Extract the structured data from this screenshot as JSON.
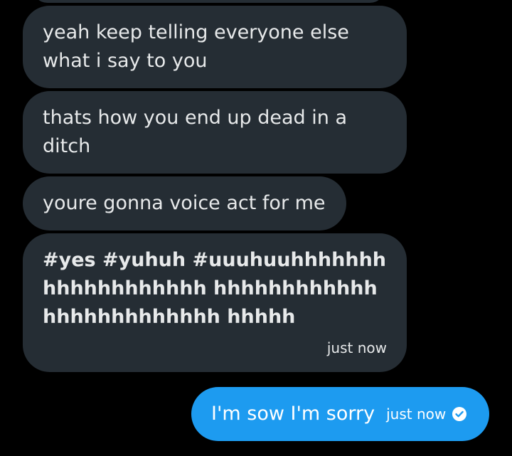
{
  "conversation": {
    "incoming": [
      {
        "text": "yeah keep telling everyone else what i say to you"
      },
      {
        "text": "thats how you end up dead in a ditch"
      },
      {
        "text": "youre gonna voice act for me"
      },
      {
        "text": "#yes #yuhuh #uuuhuuhhhhhhhhhhhhhhhhhhh hhhhhhhhhhhhhhhhhhhhhhhhh hhhhh",
        "time": "just now"
      }
    ],
    "outgoing": {
      "text": "I'm sow I'm sorry",
      "time": "just now",
      "status_icon": "check-circle-icon"
    }
  },
  "colors": {
    "background": "#000000",
    "incoming_bubble": "#252d34",
    "outgoing_bubble": "#1d9bf0",
    "text": "#e7e9ea"
  }
}
